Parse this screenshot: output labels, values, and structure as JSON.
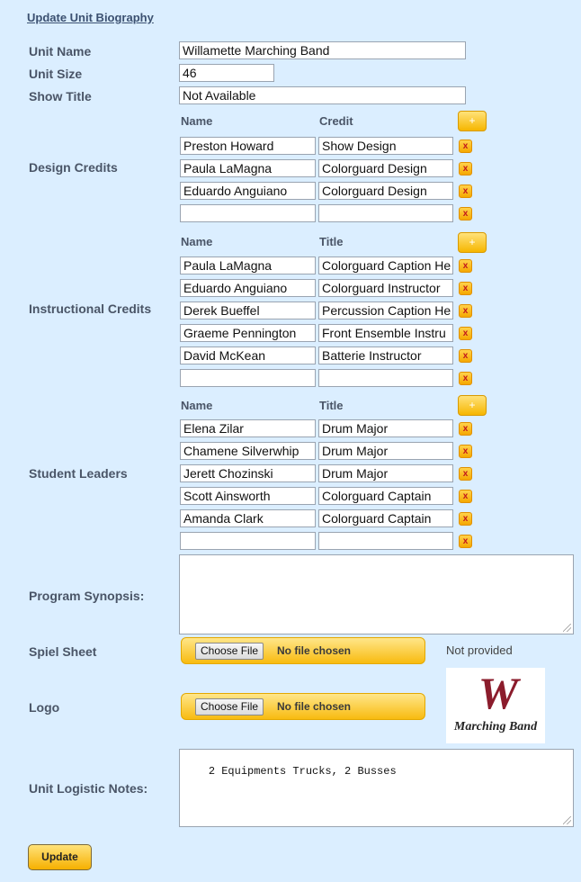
{
  "page_title": "Update Unit Biography",
  "fields": {
    "unit_name_label": "Unit Name",
    "unit_name_value": "Willamette Marching Band",
    "unit_size_label": "Unit Size",
    "unit_size_value": "46",
    "show_title_label": "Show Title",
    "show_title_value": "Not Available"
  },
  "design_credits": {
    "label": "Design Credits",
    "col1": "Name",
    "col2": "Credit",
    "add_label": "+",
    "remove_label": "x",
    "rows": [
      {
        "name": "Preston Howard",
        "value": "Show Design"
      },
      {
        "name": "Paula LaMagna",
        "value": "Colorguard Design"
      },
      {
        "name": "Eduardo Anguiano",
        "value": "Colorguard Design"
      },
      {
        "name": "",
        "value": ""
      }
    ]
  },
  "instructional_credits": {
    "label": "Instructional Credits",
    "col1": "Name",
    "col2": "Title",
    "add_label": "+",
    "remove_label": "x",
    "rows": [
      {
        "name": "Paula LaMagna",
        "value": "Colorguard Caption Hе"
      },
      {
        "name": "Eduardo Anguiano",
        "value": "Colorguard Instructor"
      },
      {
        "name": "Derek Bueffel",
        "value": "Percussion Caption He"
      },
      {
        "name": "Graeme Pennington",
        "value": "Front Ensemble Instru"
      },
      {
        "name": "David McKean",
        "value": "Batterie Instructor"
      },
      {
        "name": "",
        "value": ""
      }
    ]
  },
  "student_leaders": {
    "label": "Student Leaders",
    "col1": "Name",
    "col2": "Title",
    "add_label": "+",
    "remove_label": "x",
    "rows": [
      {
        "name": "Elena Zilar",
        "value": "Drum Major"
      },
      {
        "name": "Chamene Silverwhip",
        "value": "Drum Major"
      },
      {
        "name": "Jerett Chozinski",
        "value": "Drum Major"
      },
      {
        "name": "Scott Ainsworth",
        "value": "Colorguard Captain"
      },
      {
        "name": "Amanda Clark",
        "value": "Colorguard Captain"
      },
      {
        "name": "",
        "value": ""
      }
    ]
  },
  "program_synopsis": {
    "label": "Program Synopsis:",
    "value": ""
  },
  "spiel_sheet": {
    "label": "Spiel Sheet",
    "choose_label": "Choose File",
    "file_status": "No file chosen",
    "current": "Not provided"
  },
  "logo": {
    "label": "Logo",
    "choose_label": "Choose File",
    "file_status": "No file chosen",
    "logo_letter": "W",
    "logo_text": "Marching Band",
    "colors": {
      "logo_maroon": "#8b1c2c"
    }
  },
  "logistic_notes": {
    "label": "Unit Logistic Notes:",
    "value": "2 Equipments Trucks, 2 Busses"
  },
  "update_label": "Update",
  "colors": {
    "background": "#dbeeff",
    "accent": "#f6b600",
    "remove": "#c2181c"
  }
}
